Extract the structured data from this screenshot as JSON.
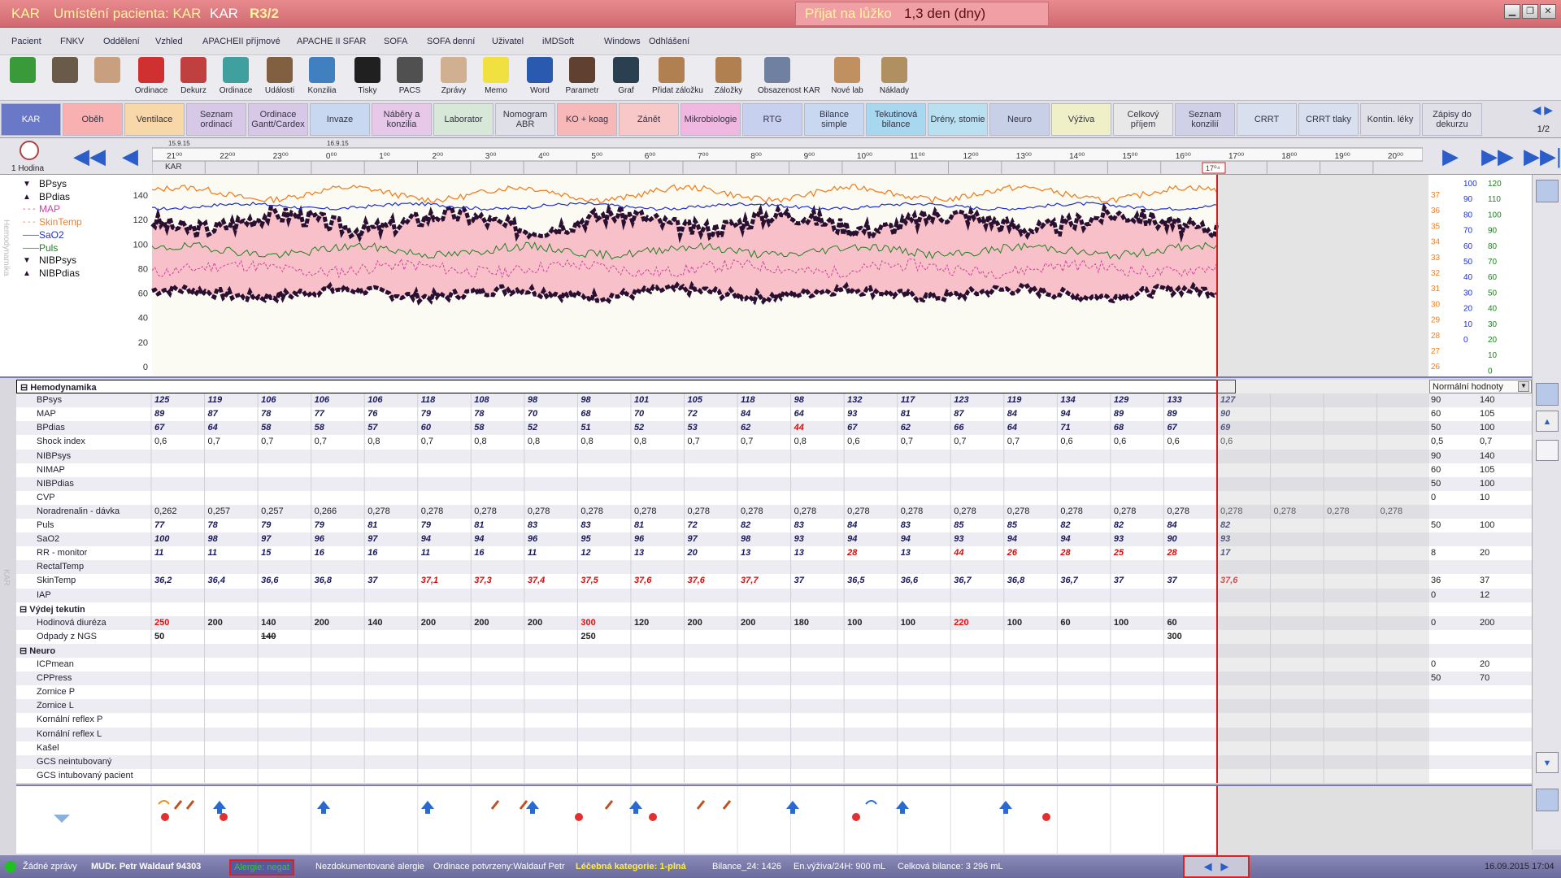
{
  "titlebar": {
    "ward": "KAR",
    "placement": "Umístění pacienta: KAR",
    "ward2": "KAR",
    "bed": "R3/2",
    "admitted_label": "Přijat na lůžko",
    "admitted_value": "1,3 den (dny)"
  },
  "menu": [
    "Pacient",
    "FNKV",
    "Oddělení",
    "Vzhled",
    "APACHEII příjmové",
    "APACHE II SFAR",
    "SOFA",
    "SOFA denní",
    "Uživatel",
    "iMDSoft",
    "Windows",
    "Odhlášení"
  ],
  "toolbar": [
    {
      "label": "",
      "icon": "refresh-icon",
      "color": "#3a9a3a"
    },
    {
      "label": "",
      "icon": "doctor-photo-icon",
      "color": "#6a5a4a"
    },
    {
      "label": "",
      "icon": "nurse-photo-icon",
      "color": "#c8a080"
    },
    {
      "label": "Ordinace",
      "icon": "alarm-clock-icon",
      "color": "#d03030"
    },
    {
      "label": "Dekurz",
      "icon": "books-icon",
      "color": "#c04040"
    },
    {
      "label": "Ordinace",
      "icon": "database-icon",
      "color": "#40a0a0"
    },
    {
      "label": "Události",
      "icon": "person-icon",
      "color": "#806040"
    },
    {
      "label": "Konzilia",
      "icon": "surgeon-icon",
      "color": "#4080c0"
    },
    {
      "label": "Tisky",
      "icon": "printer-icon",
      "color": "#202020"
    },
    {
      "label": "PACS",
      "icon": "xray-icon",
      "color": "#505050"
    },
    {
      "label": "Zprávy",
      "icon": "envelope-icon",
      "color": "#d0b090"
    },
    {
      "label": "Memo",
      "icon": "sticky-note-icon",
      "color": "#f0e040"
    },
    {
      "label": "Word",
      "icon": "word-icon",
      "color": "#2a5ab0"
    },
    {
      "label": "Parametr",
      "icon": "binoculars-icon",
      "color": "#604030"
    },
    {
      "label": "Graf",
      "icon": "chart-monitor-icon",
      "color": "#2a4050"
    },
    {
      "label": "Přidat záložku",
      "icon": "add-bookmark-icon",
      "color": "#b08050"
    },
    {
      "label": "Záložky",
      "icon": "bookmarks-icon",
      "color": "#b08050"
    },
    {
      "label": "Obsazenost KAR",
      "icon": "occupancy-icon",
      "color": "#7080a0"
    },
    {
      "label": "Nové lab",
      "icon": "lab-icon",
      "color": "#c09060"
    },
    {
      "label": "Náklady",
      "icon": "money-bag-icon",
      "color": "#b09060"
    }
  ],
  "tabs": [
    {
      "label": "KAR",
      "color": "#6a78c8",
      "text": "#fff"
    },
    {
      "label": "Oběh",
      "color": "#f8b0b0",
      "text": "#334"
    },
    {
      "label": "Ventilace",
      "color": "#f8d8a8",
      "text": "#334"
    },
    {
      "label": "Seznam ordinací",
      "color": "#d8c8e8",
      "text": "#334"
    },
    {
      "label": "Ordinace Gantt/Cardex",
      "color": "#d8c8e8",
      "text": "#334"
    },
    {
      "label": "Invaze",
      "color": "#c8d8f0",
      "text": "#334"
    },
    {
      "label": "Náběry a konzilia",
      "color": "#e8c8e8",
      "text": "#334"
    },
    {
      "label": "Laborator",
      "color": "#d8e8d8",
      "text": "#334"
    },
    {
      "label": "Nomogram ABR",
      "color": "#e0e0e8",
      "text": "#334"
    },
    {
      "label": "KO + koag",
      "color": "#f8b8b8",
      "text": "#334"
    },
    {
      "label": "Zánět",
      "color": "#f8c8c8",
      "text": "#334"
    },
    {
      "label": "Mikrobiologie",
      "color": "#f0b8e0",
      "text": "#334"
    },
    {
      "label": "RTG",
      "color": "#c8d0f0",
      "text": "#334"
    },
    {
      "label": "Bilance simple",
      "color": "#c8d8f0",
      "text": "#334"
    },
    {
      "label": "Tekutinová bilance",
      "color": "#a8d8f0",
      "text": "#334"
    },
    {
      "label": "Drény, stomie",
      "color": "#b8e0f0",
      "text": "#334"
    },
    {
      "label": "Neuro",
      "color": "#c8d0e8",
      "text": "#334"
    },
    {
      "label": "Výživa",
      "color": "#f0f0c8",
      "text": "#334"
    },
    {
      "label": "Celkový příjem",
      "color": "#e8e8e8",
      "text": "#334"
    },
    {
      "label": "Seznam konzilií",
      "color": "#d0d0e8",
      "text": "#334"
    },
    {
      "label": "CRRT",
      "color": "#d8e0f0",
      "text": "#334"
    },
    {
      "label": "CRRT tlaky",
      "color": "#d8e0f0",
      "text": "#334"
    },
    {
      "label": "Kontin. léky",
      "color": "#e0e0e8",
      "text": "#334"
    },
    {
      "label": "Zápisy do dekurzu",
      "color": "#e0e0e8",
      "text": "#334"
    }
  ],
  "tabpage": "1/2",
  "timebar": {
    "interval": "1 Hodina",
    "dates": [
      "15.9.15",
      "16.9.15"
    ],
    "hours": [
      "21⁰⁰",
      "22⁰⁰",
      "23⁰⁰",
      "0⁰⁰",
      "1⁰⁰",
      "2⁰⁰",
      "3⁰⁰",
      "4⁰⁰",
      "5⁰⁰",
      "6⁰⁰",
      "7⁰⁰",
      "8⁰⁰",
      "9⁰⁰",
      "10⁰⁰",
      "11⁰⁰",
      "12⁰⁰",
      "13⁰⁰",
      "14⁰⁰",
      "15⁰⁰",
      "16⁰⁰",
      "17⁰⁰",
      "18⁰⁰",
      "19⁰⁰",
      "20⁰⁰"
    ],
    "ward_label": "KAR",
    "now": "17⁰⁴"
  },
  "chart_data": {
    "type": "line",
    "series": [
      {
        "name": "BPsys",
        "color": "#2a1030"
      },
      {
        "name": "BPdias",
        "color": "#2a1030"
      },
      {
        "name": "MAP",
        "color": "#d040a0"
      },
      {
        "name": "SkinTemp",
        "color": "#f08020"
      },
      {
        "name": "SaO2",
        "color": "#2030c8"
      },
      {
        "name": "Puls",
        "color": "#208020"
      },
      {
        "name": "NIBPsys",
        "color": "#2a1030"
      },
      {
        "name": "NIBPdias",
        "color": "#2a1030"
      }
    ],
    "left_axis": [
      "140",
      "120",
      "100",
      "80",
      "60",
      "40",
      "20",
      "0"
    ],
    "temp_axis": [
      "37",
      "36",
      "35",
      "34",
      "33",
      "32",
      "31",
      "30",
      "29",
      "28",
      "27",
      "26"
    ],
    "sao2_axis": [
      "100",
      "90",
      "80",
      "70",
      "60",
      "50",
      "40",
      "30",
      "20",
      "10",
      "0"
    ],
    "puls_axis": [
      "120",
      "110",
      "100",
      "90",
      "80",
      "70",
      "60",
      "50",
      "40",
      "30",
      "20",
      "10",
      "0"
    ],
    "ylim": [
      0,
      150
    ]
  },
  "side_labels": {
    "hemo": "Hemodynamika",
    "kar": "KAR"
  },
  "normal_header": "Normální hodnoty",
  "grid": [
    {
      "name": "Hemodynamika",
      "section": true
    },
    {
      "name": "BPsys",
      "vals": [
        "125",
        "119",
        "106",
        "106",
        "106",
        "118",
        "108",
        "98",
        "98",
        "101",
        "105",
        "118",
        "98",
        "132",
        "117",
        "123",
        "119",
        "134",
        "129",
        "133",
        "127"
      ],
      "red": [],
      "style": "i",
      "n": [
        "90",
        "140"
      ]
    },
    {
      "name": "MAP",
      "vals": [
        "89",
        "87",
        "78",
        "77",
        "76",
        "79",
        "78",
        "70",
        "68",
        "70",
        "72",
        "84",
        "64",
        "93",
        "81",
        "87",
        "84",
        "94",
        "89",
        "89",
        "90"
      ],
      "red": [],
      "style": "i",
      "n": [
        "60",
        "105"
      ]
    },
    {
      "name": "BPdias",
      "vals": [
        "67",
        "64",
        "58",
        "58",
        "57",
        "60",
        "58",
        "52",
        "51",
        "52",
        "53",
        "62",
        "44",
        "67",
        "62",
        "66",
        "64",
        "71",
        "68",
        "67",
        "69"
      ],
      "red": [
        12
      ],
      "style": "i",
      "n": [
        "50",
        "100"
      ]
    },
    {
      "name": "Shock index",
      "vals": [
        "0,6",
        "0,7",
        "0,7",
        "0,7",
        "0,8",
        "0,7",
        "0,8",
        "0,8",
        "0,8",
        "0,8",
        "0,7",
        "0,7",
        "0,8",
        "0,6",
        "0,7",
        "0,7",
        "0,7",
        "0,6",
        "0,6",
        "0,6",
        "0,6"
      ],
      "red": "all",
      "style": "p",
      "n": [
        "0,5",
        "0,7"
      ]
    },
    {
      "name": "NIBPsys",
      "vals": [],
      "n": [
        "90",
        "140"
      ]
    },
    {
      "name": "NIMAP",
      "vals": [],
      "n": [
        "60",
        "105"
      ]
    },
    {
      "name": "NIBPdias",
      "vals": [],
      "n": [
        "50",
        "100"
      ]
    },
    {
      "name": "CVP",
      "vals": [],
      "n": [
        "0",
        "10"
      ]
    },
    {
      "name": "Noradrenalin - dávka",
      "vals": [
        "0,262",
        "0,257",
        "0,257",
        "0,266",
        "0,278",
        "0,278",
        "0,278",
        "0,278",
        "0,278",
        "0,278",
        "0,278",
        "0,278",
        "0,278",
        "0,278",
        "0,278",
        "0,278",
        "0,278",
        "0,278",
        "0,278",
        "0,278",
        "0,278",
        "0,278",
        "0,278",
        "0,278"
      ],
      "red": [],
      "style": "p",
      "n": []
    },
    {
      "name": "Puls",
      "vals": [
        "77",
        "78",
        "79",
        "79",
        "81",
        "79",
        "81",
        "83",
        "83",
        "81",
        "72",
        "82",
        "83",
        "84",
        "83",
        "85",
        "85",
        "82",
        "82",
        "84",
        "82"
      ],
      "red": [],
      "style": "i",
      "n": [
        "50",
        "100"
      ]
    },
    {
      "name": "SaO2",
      "vals": [
        "100",
        "98",
        "97",
        "96",
        "97",
        "94",
        "94",
        "96",
        "95",
        "96",
        "97",
        "98",
        "93",
        "94",
        "94",
        "93",
        "94",
        "94",
        "93",
        "90",
        "93"
      ],
      "red": [],
      "style": "i",
      "n": []
    },
    {
      "name": "RR - monitor",
      "vals": [
        "11",
        "11",
        "15",
        "16",
        "16",
        "11",
        "16",
        "11",
        "12",
        "13",
        "20",
        "13",
        "13",
        "28",
        "13",
        "44",
        "26",
        "28",
        "25",
        "28",
        "17"
      ],
      "red": [
        13,
        15,
        16,
        17,
        18,
        19
      ],
      "style": "i",
      "n": [
        "8",
        "20"
      ]
    },
    {
      "name": "RectalTemp",
      "vals": [],
      "n": []
    },
    {
      "name": "SkinTemp",
      "vals": [
        "36,2",
        "36,4",
        "36,6",
        "36,8",
        "37",
        "37,1",
        "37,3",
        "37,4",
        "37,5",
        "37,6",
        "37,6",
        "37,7",
        "37",
        "36,5",
        "36,6",
        "36,7",
        "36,8",
        "36,7",
        "37",
        "37",
        "37,6"
      ],
      "red": [
        5,
        6,
        7,
        8,
        9,
        10,
        11,
        20
      ],
      "style": "i",
      "n": [
        "36",
        "37"
      ]
    },
    {
      "name": "IAP",
      "vals": [],
      "n": [
        "0",
        "12"
      ]
    },
    {
      "name": "Výdej tekutin",
      "section": true
    },
    {
      "name": "Hodinová diuréza",
      "vals": [
        "250",
        "200",
        "140",
        "200",
        "140",
        "200",
        "200",
        "200",
        "300",
        "120",
        "200",
        "200",
        "180",
        "100",
        "100",
        "220",
        "100",
        "60",
        "100",
        "60"
      ],
      "red": [
        0,
        8,
        15
      ],
      "style": "pb",
      "n": [
        "0",
        "200"
      ]
    },
    {
      "name": "Odpady z NGS",
      "vals": [
        "50",
        "",
        "140",
        "",
        "",
        "",
        "",
        "",
        "250",
        "",
        "",
        "",
        "",
        "",
        "",
        "",
        "",
        "",
        "",
        "300"
      ],
      "red": [],
      "style": "pb",
      "strike": [
        2
      ],
      "n": []
    },
    {
      "name": "Neuro",
      "section": true
    },
    {
      "name": "ICPmean",
      "vals": [],
      "n": [
        "0",
        "20"
      ]
    },
    {
      "name": "CPPress",
      "vals": [],
      "n": [
        "50",
        "70"
      ]
    },
    {
      "name": "Zornice P",
      "vals": [],
      "n": []
    },
    {
      "name": "Zornice L",
      "vals": [],
      "n": []
    },
    {
      "name": "Kornální reflex P",
      "vals": [],
      "n": []
    },
    {
      "name": "Kornální reflex L",
      "vals": [],
      "n": []
    },
    {
      "name": "Kašel",
      "vals": [],
      "n": []
    },
    {
      "name": "GCS neintubovaný",
      "vals": [],
      "n": []
    },
    {
      "name": "GCS intubovaný pacient",
      "vals": [],
      "n": []
    }
  ],
  "status": {
    "messages": "Žádné zprávy",
    "doctor": "MUDr. Petr Waldauf 94303",
    "allergy": "Alergie: negat",
    "undoc": "Nezdokumentované alergie",
    "orders": "Ordinace potvrzeny:Waldauf Petr",
    "category": "Léčebná kategorie: 1-plná",
    "balance24": "Bilance_24: 1426",
    "nutrition": "En.výživa/24H: 900 mL",
    "total": "Celková bilance: 3 296 mL",
    "datetime": "16.09.2015 17:04"
  }
}
